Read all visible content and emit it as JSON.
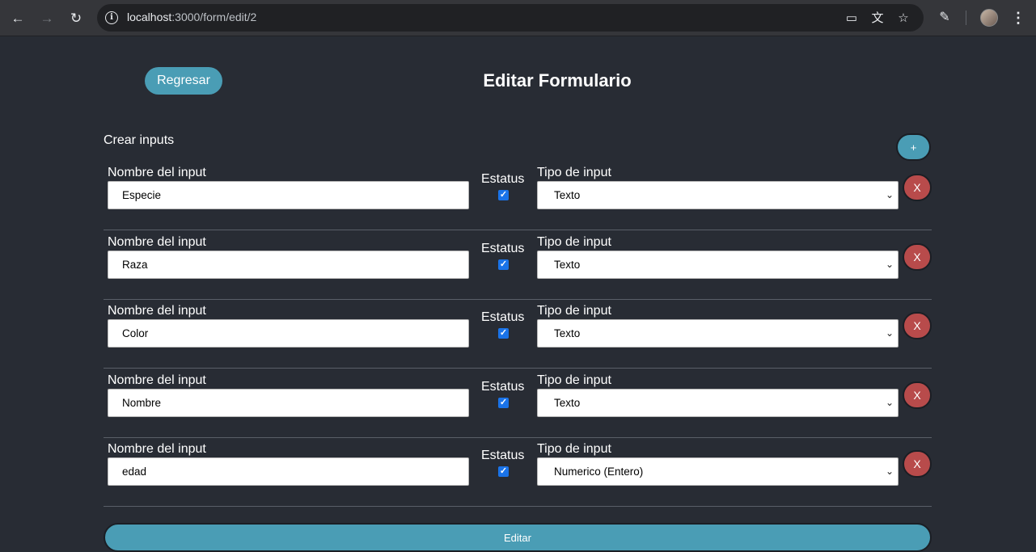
{
  "browser": {
    "url_host": "localhost",
    "url_path": ":3000/form/edit/2",
    "icons": {
      "back": "arrow-left",
      "forward": "arrow-right",
      "reload": "reload",
      "info": "info-circle",
      "install": "install-app",
      "translate": "translate",
      "bookmark": "star",
      "extensions": "puzzle",
      "profile": "avatar",
      "menu": "kebab-menu"
    }
  },
  "header": {
    "back_label": "Regresar",
    "title": "Editar Formulario"
  },
  "section": {
    "label": "Crear inputs",
    "add_label": "+"
  },
  "labels": {
    "name": "Nombre del input",
    "status": "Estatus",
    "type": "Tipo de input",
    "delete": "X"
  },
  "rows": [
    {
      "name": "Especie",
      "status": true,
      "type": "Texto"
    },
    {
      "name": "Raza",
      "status": true,
      "type": "Texto"
    },
    {
      "name": "Color",
      "status": true,
      "type": "Texto"
    },
    {
      "name": "Nombre",
      "status": true,
      "type": "Texto"
    },
    {
      "name": "edad",
      "status": true,
      "type": "Numerico (Entero)"
    }
  ],
  "submit_label": "Editar",
  "colors": {
    "background": "#282c34",
    "primary": "#4a9db5",
    "danger": "#b84b4b",
    "checkbox": "#1a73e8"
  }
}
